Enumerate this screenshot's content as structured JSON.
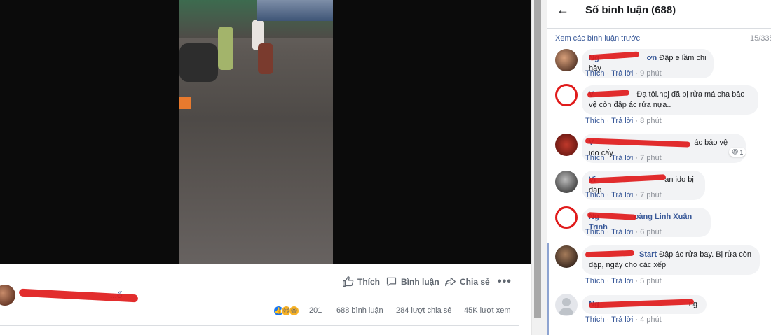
{
  "post": {
    "actions": {
      "like": "Thích",
      "comment": "Bình luận",
      "share": "Chia sẻ",
      "more": "•••"
    },
    "author_name_suffix": "...ổ",
    "reactions_count": "201",
    "comments_count": "688 bình luận",
    "shares_count": "284 lượt chia sẻ",
    "views_count": "45K lượt xem"
  },
  "panel": {
    "back": "←",
    "title": "Số bình luận (688)",
    "prev_comments": "Xem các bình luận trước",
    "comment_count": "15/335"
  },
  "comments": [
    {
      "author": "Ng",
      "author_tail": "ơn",
      "text": "Đập e lầm chi hầy",
      "like": "Thích",
      "reply": "Trả lời",
      "time": "9 phút"
    },
    {
      "author": "V",
      "author_tail": "",
      "text": "Đạ tội.hpj đã bị rửa má cha bảo vệ còn đập ác rửa nựa..",
      "like": "Thích",
      "reply": "Trả lời",
      "time": "8 phút"
    },
    {
      "author": "V",
      "author_tail": "",
      "text": "ác bảo vệ ido cẩy",
      "like": "Thích",
      "reply": "Trả lời",
      "time": "7 phút",
      "badge": "1"
    },
    {
      "author": "Vi",
      "author_tail": "",
      "text": "an ido bị đập",
      "like": "Thích",
      "reply": "Trả lời",
      "time": "7 phút"
    },
    {
      "author": "Ng",
      "author_tail": "oàng",
      "text": "Linh Xuân Trịnh",
      "like": "Thích",
      "reply": "Trả lời",
      "time": "6 phút"
    },
    {
      "author": "",
      "author_tail": "Start",
      "text": "Đập ác rửa bay. Bị rửa còn đập, ngày cho các xếp",
      "like": "Thích",
      "reply": "Trả lời",
      "time": "5 phút"
    },
    {
      "author": "Ng",
      "author_tail": "",
      "text": "ng",
      "like": "Thích",
      "reply": "Trả lời",
      "time": "4 phút"
    }
  ],
  "colors": {
    "link": "#385898",
    "bubble": "#f2f3f5",
    "redaction": "#e01b1b"
  },
  "icons": [
    "back-arrow-icon",
    "like-icon",
    "comment-icon",
    "share-icon",
    "more-icon"
  ]
}
